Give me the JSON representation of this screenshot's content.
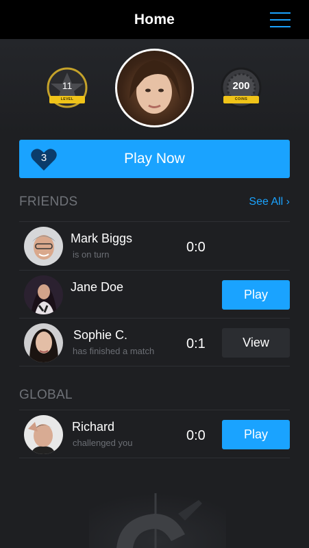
{
  "header": {
    "title": "Home"
  },
  "profile": {
    "level_value": "11",
    "level_label": "LEVEL",
    "coins_value": "200",
    "coins_label": "COINS"
  },
  "play_now": {
    "lives": "3",
    "label": "Play Now"
  },
  "friends": {
    "title": "FRIENDS",
    "see_all": "See All",
    "rows": [
      {
        "name": "Mark Biggs",
        "status": "is on turn",
        "score": "0:0",
        "action": ""
      },
      {
        "name": "Jane Doe",
        "status": "",
        "score": "",
        "action": "Play"
      },
      {
        "name": "Sophie C.",
        "status": "has finished a match",
        "score": "0:1",
        "action": "View"
      }
    ]
  },
  "global": {
    "title": "GLOBAL",
    "rows": [
      {
        "name": "Richard",
        "status": "challenged you",
        "score": "0:0",
        "action": "Play"
      }
    ]
  },
  "colors": {
    "accent": "#1aa3ff",
    "background": "#1e1f22",
    "header_bg": "#000000",
    "ribbon": "#f0c419",
    "muted_text": "#6f7278"
  },
  "icons": [
    "menu-icon",
    "star-icon",
    "coin-icon",
    "heart-icon",
    "chevron-right-icon"
  ]
}
